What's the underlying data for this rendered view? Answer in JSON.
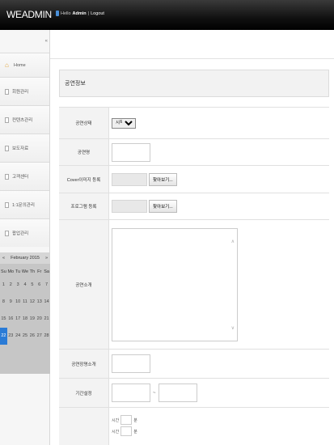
{
  "app": {
    "brand": "WEADMIN"
  },
  "user": {
    "hello": "Hello",
    "name": "Admin",
    "sep": "|",
    "logout": "Logout"
  },
  "sidebar": {
    "collapse_glyph": "«",
    "items": [
      {
        "label": "Home",
        "icon": "home-icon"
      },
      {
        "label": "회원관리",
        "icon": "page-icon"
      },
      {
        "label": "컨텐츠관리",
        "icon": "page-icon"
      },
      {
        "label": "보도자료",
        "icon": "page-icon"
      },
      {
        "label": "고객센터",
        "icon": "page-icon"
      },
      {
        "label": "1:1문의관리",
        "icon": "page-icon"
      },
      {
        "label": "팝업관리",
        "icon": "page-icon"
      }
    ]
  },
  "calendar": {
    "prev": "«",
    "next": "»",
    "month_label": "February 2015",
    "days_of_week": [
      "Su",
      "Mo",
      "Tu",
      "We",
      "Th",
      "Fr",
      "Sa"
    ],
    "weeks": [
      [
        "1",
        "2",
        "3",
        "4",
        "5",
        "6",
        "7"
      ],
      [
        "8",
        "9",
        "10",
        "11",
        "12",
        "13",
        "14"
      ],
      [
        "15",
        "16",
        "17",
        "18",
        "19",
        "20",
        "21"
      ],
      [
        "22",
        "23",
        "24",
        "25",
        "26",
        "27",
        "28"
      ]
    ],
    "today": "22"
  },
  "main": {
    "section_title": "공연정보",
    "fields": {
      "status_label": "공연상태",
      "status_value": "시작공연",
      "name_label": "공연명",
      "cover_label": "Cover이미지 등록",
      "program_label": "프로그램 등록",
      "browse_label": "찾아보기...",
      "intro_label": "공연소개",
      "venue_label": "공연장명소개",
      "period_label": "기간설정",
      "period_sep": "~",
      "hour_row1": [
        "시간",
        "분"
      ],
      "hour_row2": [
        "시간",
        "분"
      ]
    }
  }
}
